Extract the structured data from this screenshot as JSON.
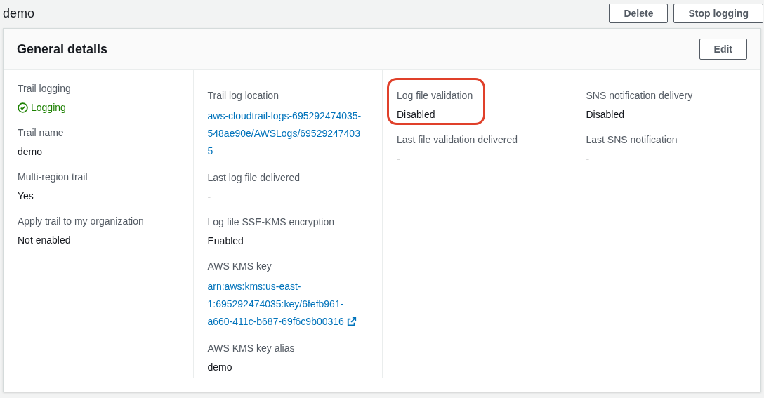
{
  "page": {
    "title": "demo",
    "buttons": [
      "Delete",
      "Stop logging"
    ]
  },
  "card": {
    "title": "General details",
    "button": "Edit",
    "columns": [
      [
        {
          "label": "Trail logging",
          "value": "Logging",
          "kind": "status",
          "highlighted": false
        },
        {
          "label": "Trail name",
          "value": "demo",
          "kind": "text",
          "highlighted": false
        },
        {
          "label": "Multi-region trail",
          "value": "Yes",
          "kind": "text",
          "highlighted": false
        },
        {
          "label": "Apply trail to my organization",
          "value": "Not enabled",
          "kind": "text",
          "highlighted": false
        }
      ],
      [
        {
          "label": "Trail log location",
          "value": "aws-cloudtrail-logs-695292474035-548ae90e/AWSLogs/695292474035",
          "kind": "link",
          "highlighted": false
        },
        {
          "label": "Last log file delivered",
          "value": "-",
          "kind": "text",
          "highlighted": false
        },
        {
          "label": "Log file SSE-KMS encryption",
          "value": "Enabled",
          "kind": "text",
          "highlighted": false
        },
        {
          "label": "AWS KMS key",
          "value": "arn:aws:kms:us-east-1:695292474035:key/6fefb961-a660-411c-b687-69f6c9b00316",
          "kind": "external_link",
          "highlighted": false
        },
        {
          "label": "AWS KMS key alias",
          "value": "demo",
          "kind": "text",
          "highlighted": false
        }
      ],
      [
        {
          "label": "Log file validation",
          "value": "Disabled",
          "kind": "text",
          "highlighted": true
        },
        {
          "label": "Last file validation delivered",
          "value": "-",
          "kind": "text",
          "highlighted": false
        }
      ],
      [
        {
          "label": "SNS notification delivery",
          "value": "Disabled",
          "kind": "text",
          "highlighted": false
        },
        {
          "label": "Last SNS notification",
          "value": "-",
          "kind": "text",
          "highlighted": false
        }
      ]
    ]
  }
}
